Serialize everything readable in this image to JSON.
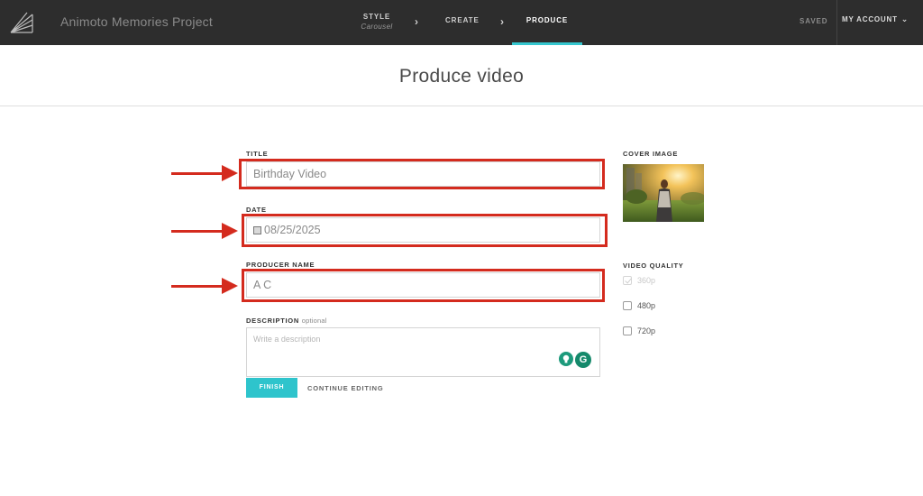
{
  "topbar": {
    "project_title": "Animoto Memories Project",
    "steps": [
      {
        "label": "STYLE",
        "sub": "Carousel"
      },
      {
        "label": "CREATE"
      },
      {
        "label": "PRODUCE"
      }
    ],
    "saved": "SAVED",
    "account": "MY ACCOUNT",
    "accent_color": "#35c6ce"
  },
  "page_title": "Produce video",
  "form": {
    "title_label": "TITLE",
    "title_value": "Birthday Video",
    "date_label": "DATE",
    "date_value": "08/25/2025",
    "producer_label": "PRODUCER NAME",
    "producer_value": "A C",
    "description_label": "DESCRIPTION",
    "description_optional": "optional",
    "description_placeholder": "Write a description",
    "finish_label": "FINISH",
    "continue_label": "CONTINUE EDITING"
  },
  "sidebar": {
    "cover_label": "COVER IMAGE",
    "quality_label": "VIDEO QUALITY",
    "quality_options": [
      {
        "label": "360p",
        "checked": true,
        "disabled": true
      },
      {
        "label": "480p",
        "checked": false,
        "disabled": false
      },
      {
        "label": "720p",
        "checked": false,
        "disabled": false
      }
    ]
  },
  "annotations": {
    "highlight_color": "#d42b1e"
  }
}
